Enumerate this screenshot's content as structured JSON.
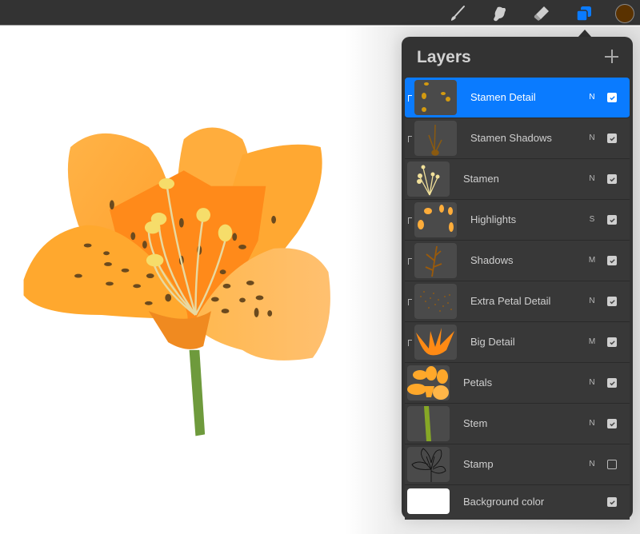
{
  "toolbar": {
    "tools": [
      {
        "name": "brush",
        "icon": "brush-icon"
      },
      {
        "name": "smudge",
        "icon": "smudge-icon"
      },
      {
        "name": "eraser",
        "icon": "eraser-icon"
      },
      {
        "name": "layers",
        "icon": "layers-icon",
        "active": true
      }
    ],
    "accent_color": "#0a7bff",
    "current_color": "#5a3200"
  },
  "layers_panel": {
    "title": "Layers",
    "add_icon": "plus-icon",
    "layers": [
      {
        "name": "Stamen Detail",
        "blend": "N",
        "visible": true,
        "clipped": true,
        "selected": true,
        "thumb": "stamen-detail"
      },
      {
        "name": "Stamen Shadows",
        "blend": "N",
        "visible": true,
        "clipped": true,
        "selected": false,
        "thumb": "stamen-shadows"
      },
      {
        "name": "Stamen",
        "blend": "N",
        "visible": true,
        "clipped": false,
        "selected": false,
        "thumb": "stamen"
      },
      {
        "name": "Highlights",
        "blend": "S",
        "visible": true,
        "clipped": true,
        "selected": false,
        "thumb": "highlights"
      },
      {
        "name": "Shadows",
        "blend": "M",
        "visible": true,
        "clipped": true,
        "selected": false,
        "thumb": "shadows"
      },
      {
        "name": "Extra Petal Detail",
        "blend": "N",
        "visible": true,
        "clipped": true,
        "selected": false,
        "thumb": "extra-petal-detail"
      },
      {
        "name": "Big Detail",
        "blend": "M",
        "visible": true,
        "clipped": true,
        "selected": false,
        "thumb": "big-detail"
      },
      {
        "name": "Petals",
        "blend": "N",
        "visible": true,
        "clipped": false,
        "selected": false,
        "thumb": "petals"
      },
      {
        "name": "Stem",
        "blend": "N",
        "visible": true,
        "clipped": false,
        "selected": false,
        "thumb": "stem"
      },
      {
        "name": "Stamp",
        "blend": "N",
        "visible": false,
        "clipped": false,
        "selected": false,
        "thumb": "stamp"
      },
      {
        "name": "Background color",
        "blend": "",
        "visible": true,
        "clipped": false,
        "selected": false,
        "thumb": "background",
        "background_color": "#ffffff"
      }
    ]
  },
  "canvas": {
    "artwork": "orange tiger lily illustration",
    "colors": {
      "petal": "#ffab3a",
      "petal_inner": "#ff8a1a",
      "spots": "#6b4a1e",
      "stamen": "#f3e08a",
      "stem": "#6e9a3c"
    }
  }
}
